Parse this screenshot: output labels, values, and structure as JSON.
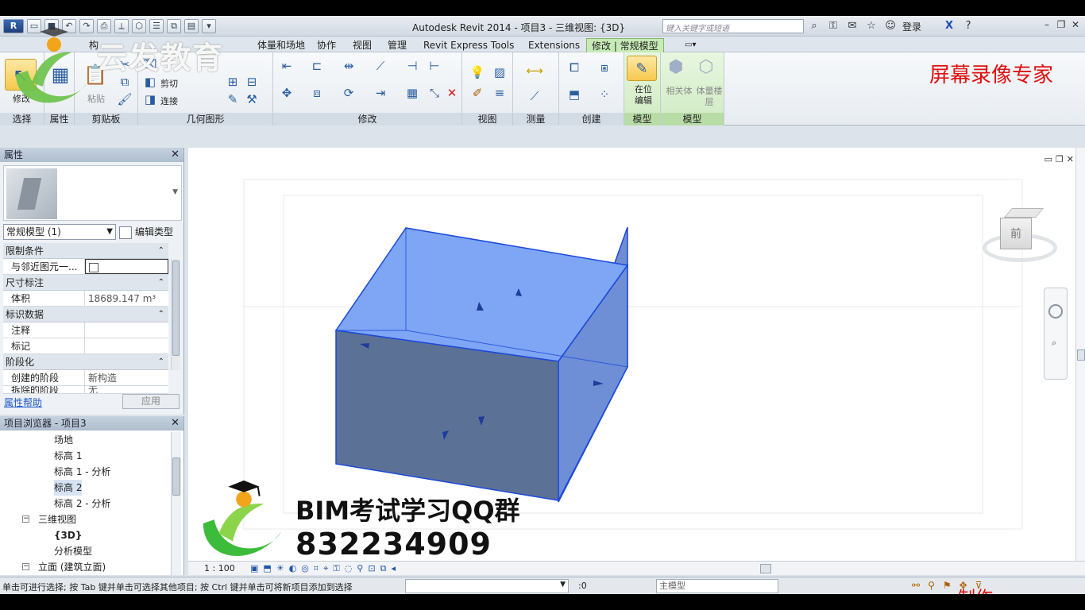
{
  "app": {
    "title": "Autodesk Revit 2014 -     项目3 - 三维视图: {3D}",
    "search_placeholder": "键入关键字或短语",
    "login": "登录"
  },
  "tabs": [
    "构",
    "体量和场地",
    "协作",
    "视图",
    "管理",
    "Revit Express Tools",
    "Extensions",
    "修改 | 常规模型"
  ],
  "ribbon": {
    "panels": [
      "选择",
      "属性",
      "剪贴板",
      "几何图形",
      "修改",
      "视图",
      "测量",
      "创建",
      "模型",
      "模型"
    ],
    "modify_label": "修改",
    "paste_label": "粘贴",
    "cut_label": "剪切",
    "join_label": "连接",
    "inplace_edit": "在位编辑",
    "related_body": "相关体",
    "mass_floor": "体量楼层"
  },
  "recorder_label": "屏幕录像专家",
  "properties": {
    "header": "属性",
    "type_selector": "常规模型 (1)",
    "edit_type": "编辑类型",
    "sections": [
      {
        "name": "限制条件",
        "rows": [
          {
            "key": "与邻近图元一...",
            "value": ""
          }
        ]
      },
      {
        "name": "尺寸标注",
        "rows": [
          {
            "key": "体积",
            "value": "18689.147 m³"
          }
        ]
      },
      {
        "name": "标识数据",
        "rows": [
          {
            "key": "注释",
            "value": ""
          },
          {
            "key": "标记",
            "value": ""
          }
        ]
      },
      {
        "name": "阶段化",
        "rows": [
          {
            "key": "创建的阶段",
            "value": "新构造"
          },
          {
            "key": "拆除的阶段",
            "value": "无"
          }
        ]
      }
    ],
    "help": "属性帮助",
    "apply": "应用"
  },
  "browser": {
    "header": "项目浏览器 - 项目3",
    "items": [
      {
        "label": "场地",
        "level": 3
      },
      {
        "label": "标高 1",
        "level": 3
      },
      {
        "label": "标高 1 - 分析",
        "level": 3
      },
      {
        "label": "标高 2",
        "level": 3,
        "selected": true
      },
      {
        "label": "标高 2 - 分析",
        "level": 3
      },
      {
        "label": "三维视图",
        "level": 2,
        "toggle": "−"
      },
      {
        "label": "{3D}",
        "level": 3,
        "bold": true
      },
      {
        "label": "分析模型",
        "level": 3
      },
      {
        "label": "立面 (建筑立面)",
        "level": 2,
        "toggle": "−"
      }
    ]
  },
  "viewport": {
    "viewcube_face": "前",
    "scale": "1 : 100"
  },
  "status": {
    "hint": "单击可进行选择; 按 Tab 键并单击可选择其他项目; 按 Ctrl 键并单击可将新项目添加到选择",
    "count": ":0",
    "model": "主模型"
  },
  "watermark": {
    "top_text": "云发教育",
    "qq_title": "BIM考试学习QQ群",
    "qq_number": "832234909",
    "made_by": "制作"
  },
  "colors": {
    "box_top": "#7ea6f4",
    "box_front": "#5c7196",
    "box_edge": "#1b49d9",
    "ribbon_green": "#c7ebb6",
    "recorder_red": "#e01010"
  }
}
